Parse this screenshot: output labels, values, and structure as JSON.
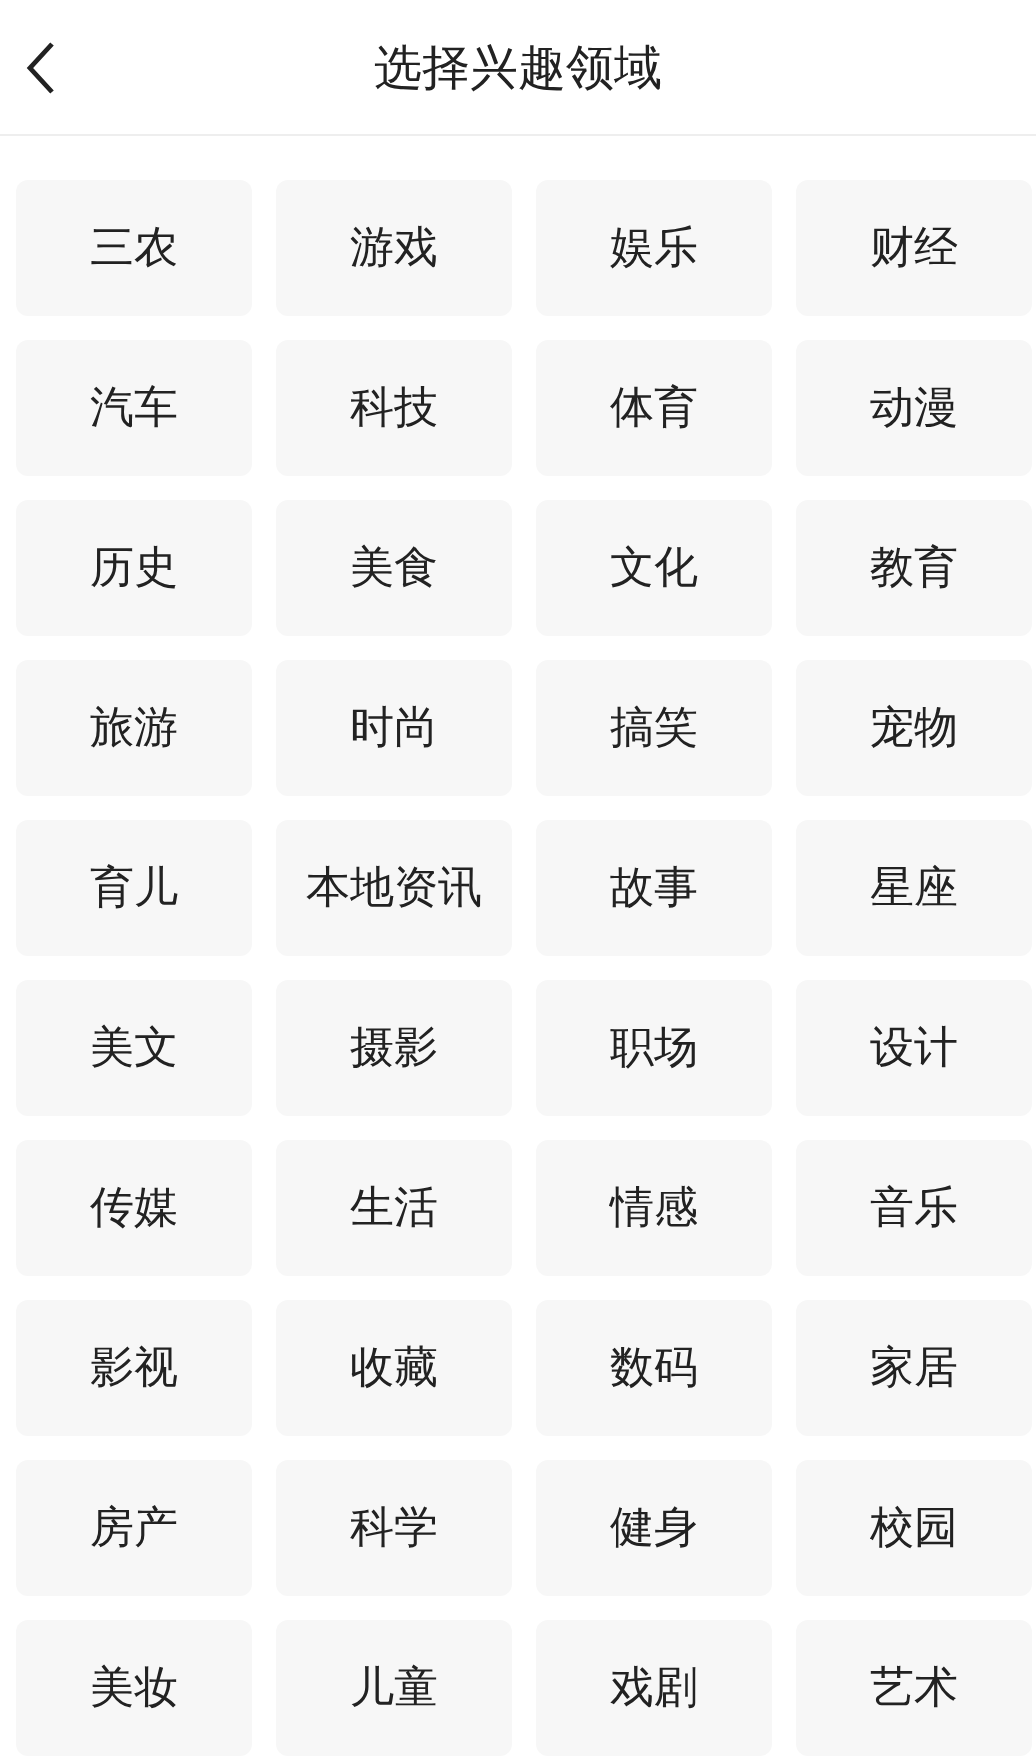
{
  "header": {
    "title": "选择兴趣领域"
  },
  "topics": [
    "三农",
    "游戏",
    "娱乐",
    "财经",
    "汽车",
    "科技",
    "体育",
    "动漫",
    "历史",
    "美食",
    "文化",
    "教育",
    "旅游",
    "时尚",
    "搞笑",
    "宠物",
    "育儿",
    "本地资讯",
    "故事",
    "星座",
    "美文",
    "摄影",
    "职场",
    "设计",
    "传媒",
    "生活",
    "情感",
    "音乐",
    "影视",
    "收藏",
    "数码",
    "家居",
    "房产",
    "科学",
    "健身",
    "校园",
    "美妆",
    "儿童",
    "戏剧",
    "艺术"
  ]
}
